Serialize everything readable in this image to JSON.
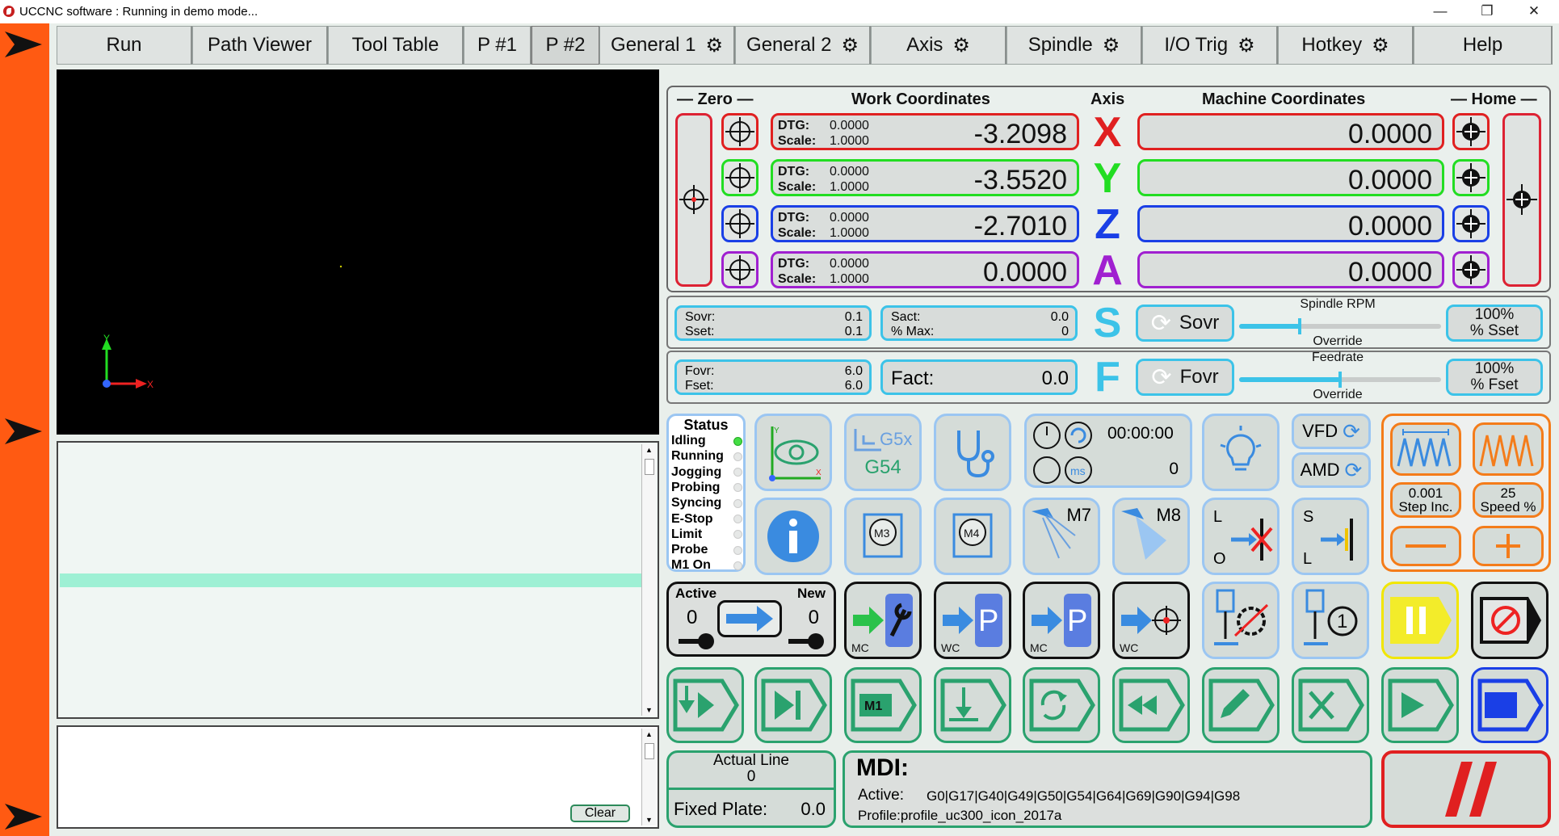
{
  "window": {
    "title": "UCCNC software : Running in demo mode...",
    "minimize": "—",
    "restore": "❐",
    "close": "✕"
  },
  "tabs": [
    {
      "label": "Run",
      "gear": false
    },
    {
      "label": "Path Viewer",
      "gear": false
    },
    {
      "label": "Tool Table",
      "gear": false
    },
    {
      "label": "P #1",
      "gear": false
    },
    {
      "label": "P #2",
      "gear": false
    },
    {
      "label": "General 1",
      "gear": true
    },
    {
      "label": "General 2",
      "gear": true
    },
    {
      "label": "Axis",
      "gear": true
    },
    {
      "label": "Spindle",
      "gear": true
    },
    {
      "label": "I/O Trig",
      "gear": true
    },
    {
      "label": "Hotkey",
      "gear": true
    },
    {
      "label": "Help",
      "gear": false
    }
  ],
  "coords": {
    "zero_label": "— Zero —",
    "work_label": "Work Coordinates",
    "axis_label": "Axis",
    "machine_label": "Machine Coordinates",
    "home_label": "— Home —",
    "dtg_label": "DTG:",
    "scale_label": "Scale:",
    "axes": [
      {
        "name": "X",
        "color": "#e02020",
        "dtg": "0.0000",
        "scale": "1.0000",
        "work": "-3.2098",
        "machine": "0.0000"
      },
      {
        "name": "Y",
        "color": "#22dd22",
        "dtg": "0.0000",
        "scale": "1.0000",
        "work": "-3.5520",
        "machine": "0.0000"
      },
      {
        "name": "Z",
        "color": "#1a3fe6",
        "dtg": "0.0000",
        "scale": "1.0000",
        "work": "-2.7010",
        "machine": "0.0000"
      },
      {
        "name": "A",
        "color": "#a020d0",
        "dtg": "0.0000",
        "scale": "1.0000",
        "work": "0.0000",
        "machine": "0.0000"
      }
    ]
  },
  "spindle": {
    "sovr_label": "Sovr:",
    "sovr": "0.1",
    "sset_label": "Sset:",
    "sset": "0.1",
    "sact_label": "Sact:",
    "sact": "0.0",
    "pmax_label": "% Max:",
    "pmax": "0",
    "letter": "S",
    "sovr_button": "Sovr",
    "title": "Spindle RPM",
    "subtitle": "Override",
    "pct": "100%",
    "pct_label": "% Sset",
    "slider_level": 0.3
  },
  "feed": {
    "fovr_label": "Fovr:",
    "fovr": "6.0",
    "fset_label": "Fset:",
    "fset": "6.0",
    "fact_label": "Fact:",
    "fact": "0.0",
    "letter": "F",
    "fovr_button": "Fovr",
    "title": "Feedrate",
    "subtitle": "Override",
    "pct": "100%",
    "pct_label": "% Fset",
    "slider_level": 0.5
  },
  "status": {
    "title": "Status",
    "items": [
      {
        "label": "Idling",
        "on": true
      },
      {
        "label": "Running",
        "on": false
      },
      {
        "label": "Jogging",
        "on": false
      },
      {
        "label": "Probing",
        "on": false
      },
      {
        "label": "Syncing",
        "on": false
      },
      {
        "label": "E-Stop",
        "on": false
      },
      {
        "label": "Limit",
        "on": false
      },
      {
        "label": "Probe",
        "on": false
      },
      {
        "label": "M1 On",
        "on": false
      }
    ]
  },
  "buttons": {
    "g5x": "G5x",
    "g54": "G54",
    "time": "00:00:00",
    "ms_value": "0",
    "vfd": "VFD",
    "amd": "AMD",
    "m3": "M3",
    "m4": "M4",
    "m7": "M7",
    "m8": "M8",
    "step_value": "0.001",
    "step_label": "Step Inc.",
    "speed_value": "25",
    "speed_label": "Speed %",
    "active_label": "Active",
    "new_label": "New",
    "active_value": "0",
    "new_value": "0",
    "mc": "MC",
    "wc": "WC",
    "m1": "M1",
    "lo_l": "L",
    "lo_o": "O",
    "sl_s": "S",
    "sl_l": "L"
  },
  "bottom": {
    "actual_line_label": "Actual Line",
    "actual_line": "0",
    "fixed_plate_label": "Fixed Plate:",
    "fixed_plate": "0.0",
    "mdi_label": "MDI:",
    "active_label": "Active:",
    "active_codes": "G0|G17|G40|G49|G50|G54|G64|G69|G90|G94|G98",
    "profile": "Profile:profile_uc300_icon_2017a",
    "clear": "Clear"
  }
}
